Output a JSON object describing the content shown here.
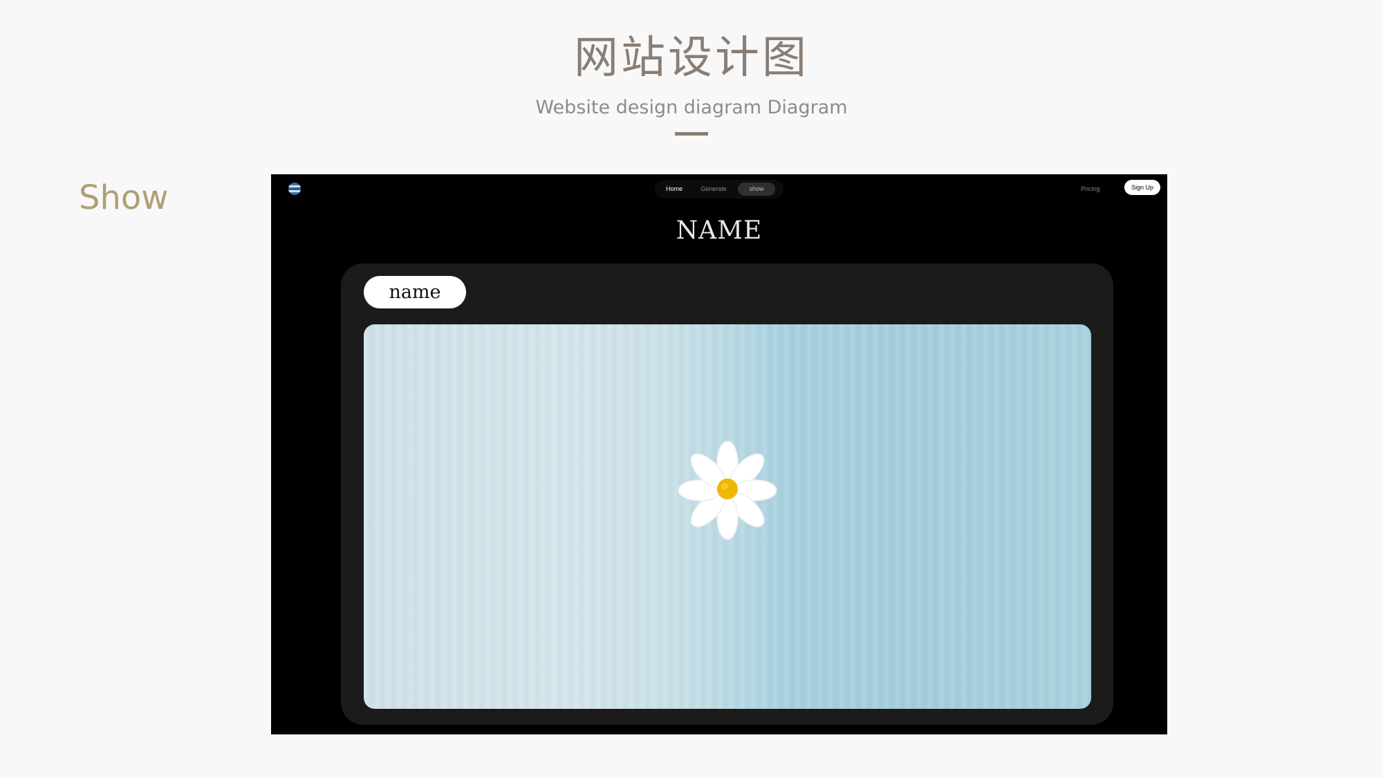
{
  "page": {
    "title": "网站设计图",
    "subtitle": "Website design diagram Diagram",
    "section_label": "Show"
  },
  "site": {
    "nav": {
      "tabs": [
        "Home",
        "Generate",
        "show"
      ],
      "active_tab": "show"
    },
    "pricing_label": "Pricing",
    "signup_label": "Sign Up",
    "hero_title": "NAME",
    "card": {
      "name_label": "name"
    }
  },
  "colors": {
    "title": "#8a7e74",
    "subtitle": "#8c8c8c",
    "section_label": "#b09e78",
    "site_background": "#000000",
    "card_background": "#1b1b1b",
    "image_left": "#cfe1e8",
    "image_right": "#a4cedd",
    "daisy_petal": "#ffffff",
    "daisy_center": "#f0b800"
  },
  "icons": {
    "logo": "globe-logo-icon",
    "artwork": "daisy-flower"
  }
}
